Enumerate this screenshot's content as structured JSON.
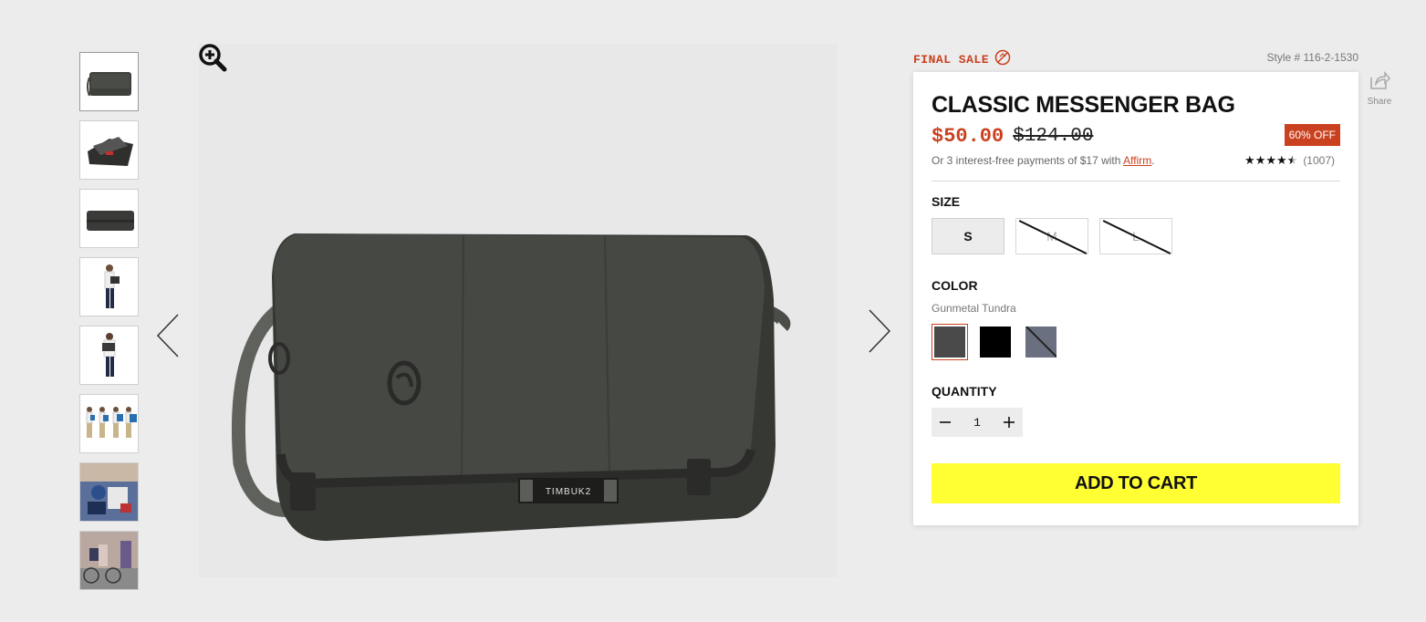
{
  "product": {
    "final_sale_label": "FINAL SALE",
    "style_number": "Style # 116-2-1530",
    "share_label": "Share",
    "title": "CLASSIC MESSENGER BAG",
    "price_now": "$50.00",
    "price_was": "$124.00",
    "discount_badge": "60% OFF",
    "payments_text": "Or 3 interest-free payments of $17 with",
    "affirm_link": "Affirm",
    "payments_suffix": ".",
    "rating_stars": "★★★★★",
    "rating_value": 4.5,
    "rating_count": "(1007)"
  },
  "size": {
    "label": "SIZE",
    "options": [
      {
        "label": "S",
        "state": "selected"
      },
      {
        "label": "M",
        "state": "unavailable"
      },
      {
        "label": "L",
        "state": "unavailable"
      }
    ]
  },
  "color": {
    "label": "COLOR",
    "selected_name": "Gunmetal Tundra",
    "swatches": [
      {
        "name": "Gunmetal Tundra",
        "hex": "#4a4a4a",
        "state": "selected"
      },
      {
        "name": "Black",
        "hex": "#000000",
        "state": "available"
      },
      {
        "name": "Slate",
        "hex": "#6a7080",
        "state": "unavailable"
      }
    ]
  },
  "quantity": {
    "label": "QUANTITY",
    "value": "1",
    "minus_icon": "minus-icon",
    "plus_icon": "plus-icon"
  },
  "cart": {
    "button_label": "ADD TO CART"
  },
  "gallery": {
    "bag_brand_label": "TIMBUK2",
    "thumbnail_count": 8,
    "icons": [
      "zoom-in-icon",
      "chevron-left-icon",
      "chevron-right-icon",
      "share-icon",
      "final-sale-icon"
    ]
  },
  "colors": {
    "accent": "#c9411f",
    "cart_button": "#ffff33",
    "background": "#ececec"
  }
}
